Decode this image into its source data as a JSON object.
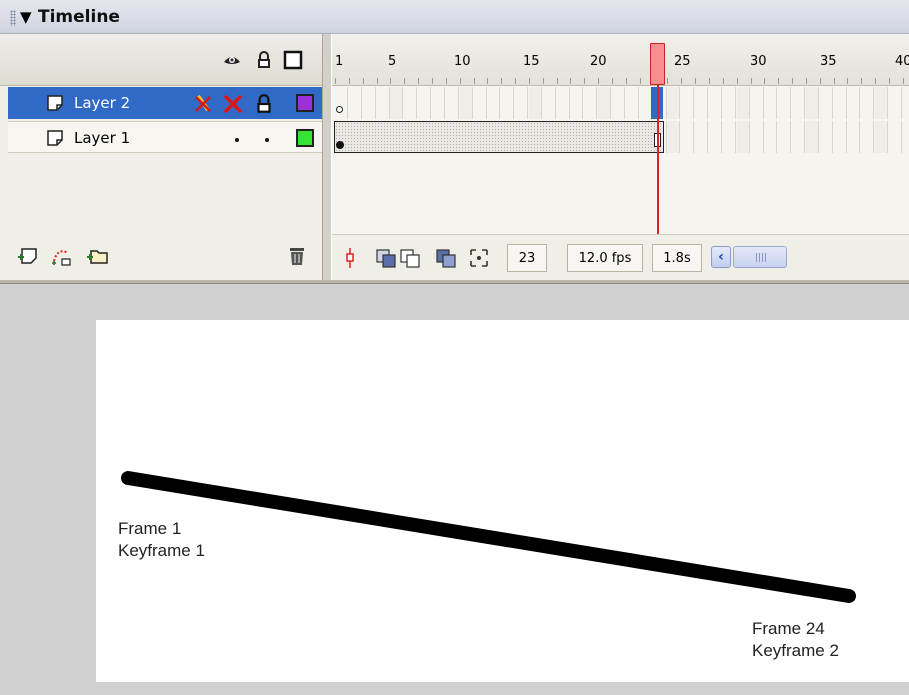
{
  "panel": {
    "title": "Timeline",
    "collapse_glyph": "▼"
  },
  "header_icons": {
    "show_hide": "eye-icon",
    "lock": "lock-icon",
    "outline": "outline-icon"
  },
  "layers": [
    {
      "name": "Layer 2",
      "selected": true,
      "visibility": "hidden",
      "lock": "unlocked",
      "outline_color": "#9b30d8",
      "icons": [
        "pencil-crossed-icon",
        "red-x-icon",
        "lock-icon"
      ]
    },
    {
      "name": "Layer 1",
      "selected": false,
      "visibility": "visible",
      "lock": "unlocked",
      "outline_color": "#33e433",
      "icons": [
        "dot",
        "dot"
      ]
    }
  ],
  "ruler": {
    "labels": [
      "1",
      "5",
      "10",
      "15",
      "20",
      "25",
      "30",
      "35",
      "40"
    ]
  },
  "playhead": {
    "current_frame": 23
  },
  "footer_status": {
    "current_frame": "23",
    "frame_rate": "12.0 fps",
    "elapsed_time": "1.8s"
  },
  "footer_icons": {
    "insert_layer": "insert-layer-icon",
    "add_motion_guide": "add-motion-guide-icon",
    "insert_folder": "insert-folder-icon",
    "delete_layer": "trash-icon",
    "center_frame": "center-frame-icon",
    "onion_skin": "onion-skin-icon",
    "onion_skin_outlines": "onion-skin-outlines-icon",
    "edit_multiple_frames": "edit-multiple-frames-icon",
    "modify_onion_markers": "modify-onion-markers-icon",
    "scroll_left": "‹"
  },
  "stage": {
    "start_label_line1": "Frame 1",
    "start_label_line2": "Keyframe 1",
    "end_label_line1": "Frame 24",
    "end_label_line2": "Keyframe 2",
    "line_color": "#000000"
  },
  "colors": {
    "selection": "#3169c6",
    "playhead": "#dd2222"
  }
}
